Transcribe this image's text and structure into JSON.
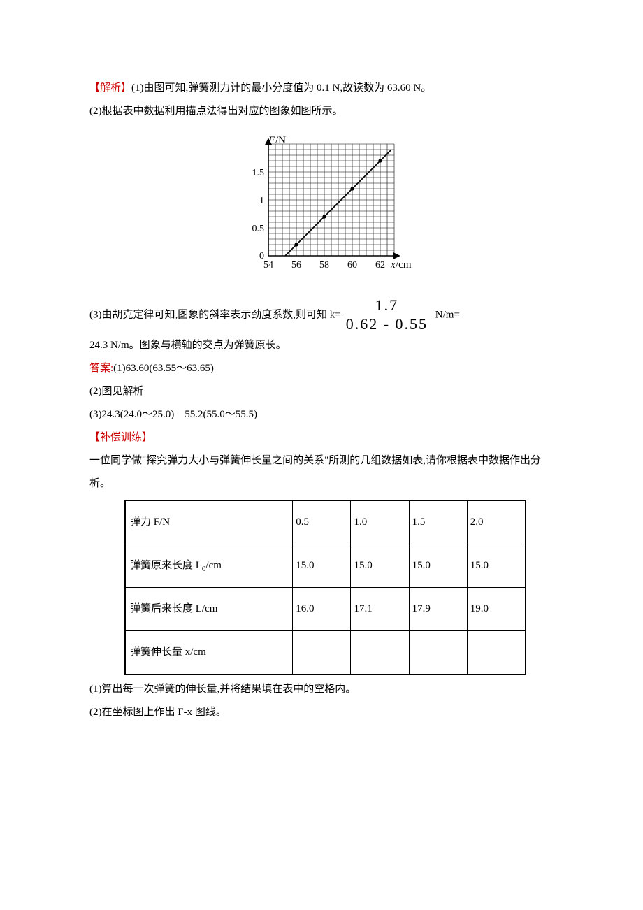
{
  "analysis": {
    "label": "【解析】",
    "p1": "(1)由图可知,弹簧测力计的最小分度值为 0.1 N,故读数为 63.60 N。",
    "p2": "(2)根据表中数据利用描点法得出对应的图象如图所示。",
    "p3_pre": "(3)由胡克定律可知,图象的斜率表示劲度系数,则可知 k=",
    "frac_num": "1.7",
    "frac_den": "0.62 - 0.55",
    "p3_post": " N/m=",
    "p4": "24.3 N/m。图象与横轴的交点为弹簧原长。"
  },
  "answers": {
    "label": "答案:",
    "a1": "(1)63.60(63.55～63.65)",
    "a2": "(2)图见解析",
    "a3": "(3)24.3(24.0～25.0)　55.2(55.0～55.5)"
  },
  "supplement": {
    "label": "【补偿训练】",
    "intro": "一位同学做\"探究弹力大小与弹簧伸长量之间的关系\"所测的几组数据如表,请你根据表中数据作出分析。",
    "q1": "(1)算出每一次弹簧的伸长量,并将结果填在表中的空格内。",
    "q2": "(2)在坐标图上作出 F-x 图线。"
  },
  "table": {
    "rows": [
      {
        "h": "弹力 F/N",
        "c": [
          "0.5",
          "1.0",
          "1.5",
          "2.0"
        ]
      },
      {
        "h": "弹簧原来长度 L₀/cm",
        "c": [
          "15.0",
          "15.0",
          "15.0",
          "15.0"
        ]
      },
      {
        "h": "弹簧后来长度 L/cm",
        "c": [
          "16.0",
          "17.1",
          "17.9",
          "19.0"
        ]
      },
      {
        "h": "弹簧伸长量 x/cm",
        "c": [
          "",
          "",
          "",
          ""
        ]
      }
    ]
  },
  "chart_data": {
    "type": "line",
    "title": "",
    "xlabel": "x/cm",
    "ylabel": "F/N",
    "xlim": [
      54,
      63
    ],
    "ylim": [
      0,
      2.0
    ],
    "xticks": [
      54,
      56,
      58,
      60,
      62
    ],
    "yticks": [
      0,
      0.5,
      1.0,
      1.5
    ],
    "series": [
      {
        "name": "data",
        "x": [
          56,
          58,
          60,
          62
        ],
        "y": [
          0.2,
          0.7,
          1.2,
          1.7
        ]
      }
    ]
  }
}
